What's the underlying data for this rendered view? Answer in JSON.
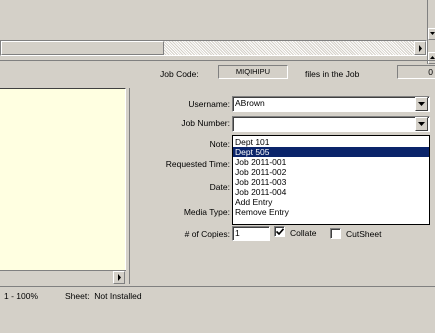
{
  "header": {
    "job_code_label": "Job Code:",
    "job_code_value": "MIQIHIPU",
    "files_label": "files in the Job",
    "files_value": "0"
  },
  "form": {
    "username_label": "Username:",
    "username_value": "ABrown",
    "job_number_label": "Job Number:",
    "job_number_value": "",
    "note_label": "Note:",
    "requested_time_label": "Requested Time:",
    "date_label": "Date:",
    "media_type_label": "Media Type:",
    "copies_label": "# of Copies:",
    "copies_value": "1",
    "collate_label": "Collate",
    "collate_checked": true,
    "cutsheet_label": "CutSheet",
    "cutsheet_checked": false
  },
  "dropdown_options": [
    {
      "label": "Dept 101",
      "selected": false
    },
    {
      "label": "Dept 505",
      "selected": true
    },
    {
      "label": "Job 2011-001",
      "selected": false
    },
    {
      "label": "Job 2011-002",
      "selected": false
    },
    {
      "label": "Job 2011-003",
      "selected": false
    },
    {
      "label": "Job 2011-004",
      "selected": false
    },
    {
      "label": "Add Entry",
      "selected": false
    },
    {
      "label": "Remove Entry",
      "selected": false
    }
  ],
  "status": {
    "zoom_text": "1 - 100%",
    "sheet_text": "Sheet:  Not Installed"
  },
  "icons": {
    "right_arrow": "scroll-right-icon",
    "down_arrow": "dropdown-arrow-icon",
    "up_arrow": "scroll-up-icon",
    "check": "check-icon"
  }
}
